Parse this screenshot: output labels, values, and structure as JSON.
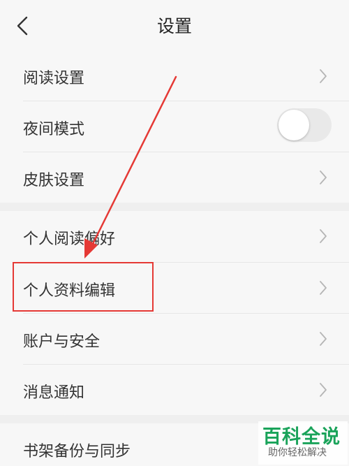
{
  "header": {
    "title": "设置",
    "back_icon": "chevron-left-icon"
  },
  "settings": {
    "reading": "阅读设置",
    "night_mode": "夜间模式",
    "night_mode_on": false,
    "skin": "皮肤设置",
    "reading_preferences": "个人阅读偏好",
    "profile_edit": "个人资料编辑",
    "account_security": "账户与安全",
    "notifications": "消息通知",
    "bookshelf_sync": "书架备份与同步"
  },
  "annotation": {
    "color": "#e53935"
  },
  "watermark": {
    "main": "百科全说",
    "sub": "助你轻松解决",
    "color": "#1aa35a"
  }
}
